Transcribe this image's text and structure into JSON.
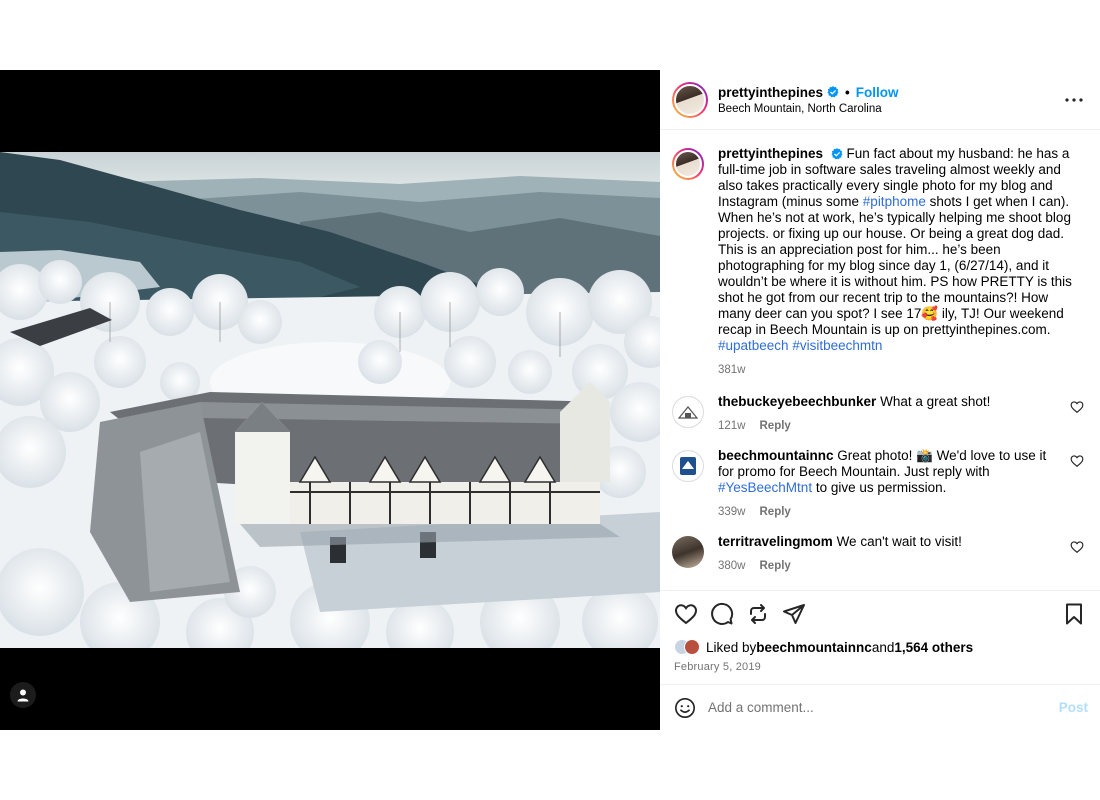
{
  "header": {
    "username": "prettyinthepines",
    "follow_label": "Follow",
    "dot": "•",
    "location": "Beech Mountain, North Carolina"
  },
  "caption": {
    "username": "prettyinthepines",
    "text_1": "Fun fact about my husband: he has a full-time job in software sales traveling almost weekly and also takes practically every single photo for my blog and Instagram (minus some ",
    "hashtag_1": "#pitphome",
    "text_2": " shots I get when I can). When he’s not at work, he’s typically helping me shoot blog projects. or fixing up our house. Or being a great dog dad. This is an appreciation post for him... he’s been photographing for my blog since day 1, (6/27/14), and it wouldn’t be where it is without him. PS how PRETTY is this shot he got from our recent trip to the mountains?! How many deer can you spot? I see 17🥰 ily, TJ! Our weekend recap in Beech Mountain is up on prettyinthepines.com. ",
    "hashtag_2": "#upatbeech",
    "hashtag_3": "#visitbeechmtn",
    "time": "381w"
  },
  "comments": [
    {
      "username": "thebuckeyebeechbunker",
      "text": "What a great shot!",
      "time": "121w",
      "reply_label": "Reply"
    },
    {
      "username": "beechmountainnc",
      "text_1": "Great photo! 📸 We'd love to use it for promo for Beech Mountain. Just reply with ",
      "hashtag": "#YesBeechMtnt",
      "text_2": " to give us permission.",
      "time": "339w",
      "reply_label": "Reply"
    },
    {
      "username": "territravelingmom",
      "text": "We can't wait to visit!",
      "time": "380w",
      "reply_label": "Reply"
    }
  ],
  "likes": {
    "prefix": "Liked by ",
    "user": "beechmountainnc",
    "middle": " and ",
    "others": "1,564 others"
  },
  "date": "February 5, 2019",
  "add_comment": {
    "placeholder": "Add a comment...",
    "post_label": "Post"
  },
  "icons": {
    "verified": "verified-badge-icon",
    "more": "more-horizontal-icon",
    "like": "heart-icon",
    "comment": "comment-bubble-icon",
    "repost": "repost-icon",
    "share": "paper-plane-icon",
    "save": "bookmark-icon",
    "emoji": "smiley-icon",
    "user_tag": "user-tag-icon"
  },
  "colors": {
    "accent": "#0095f6",
    "hashtag": "#2f6dd8",
    "muted": "#737373",
    "post_disabled": "#b2dffc"
  }
}
